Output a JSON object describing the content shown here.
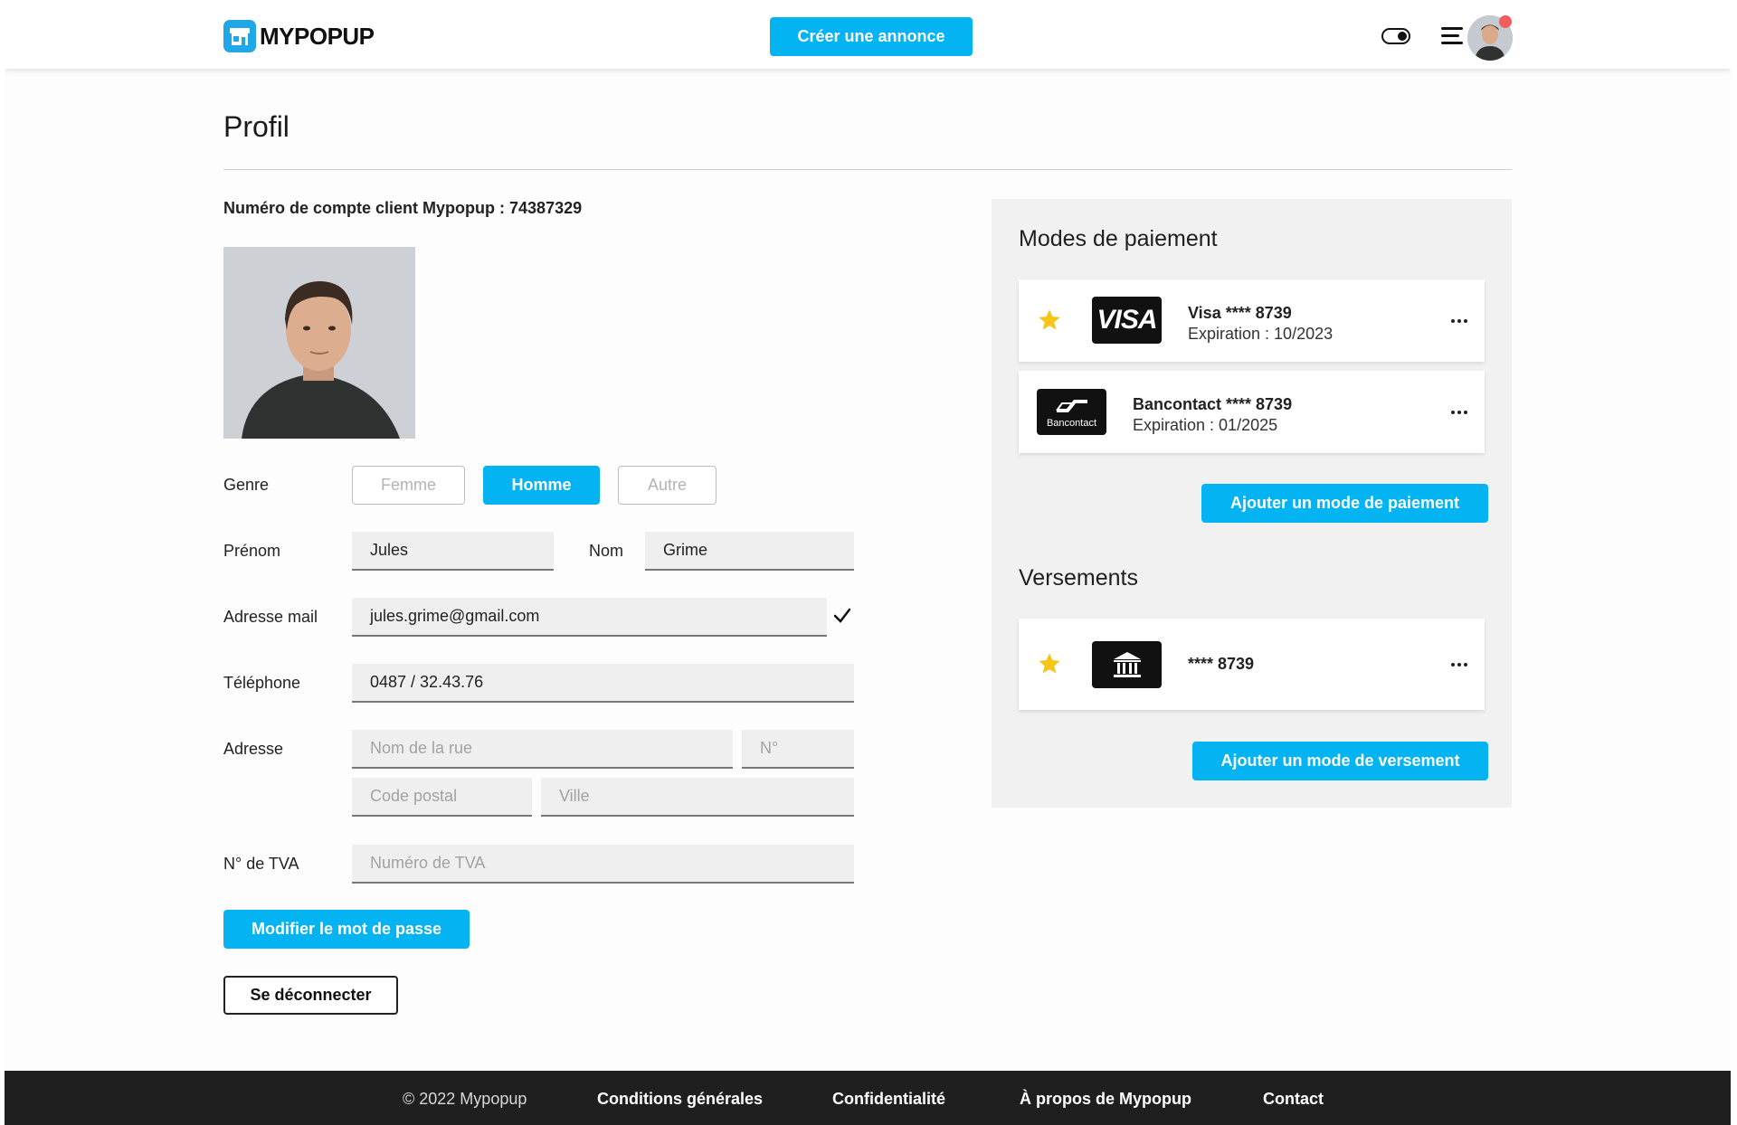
{
  "header": {
    "brand": "MYPOPUP",
    "cta_label": "Créer une annonce"
  },
  "page": {
    "title": "Profil",
    "account_line": "Numéro de compte client Mypopup : 74387329"
  },
  "form": {
    "gender": {
      "label": "Genre",
      "options": [
        "Femme",
        "Homme",
        "Autre"
      ],
      "selected": "Homme"
    },
    "first_name": {
      "label": "Prénom",
      "value": "Jules"
    },
    "last_name": {
      "label": "Nom",
      "value": "Grime"
    },
    "email": {
      "label": "Adresse mail",
      "value": "jules.grime@gmail.com"
    },
    "phone": {
      "label": "Téléphone",
      "value": "0487 / 32.43.76"
    },
    "address": {
      "label": "Adresse",
      "street_placeholder": "Nom de la rue",
      "number_placeholder": "N°",
      "postal_placeholder": "Code postal",
      "city_placeholder": "Ville"
    },
    "vat": {
      "label": "N° de TVA",
      "placeholder": "Numéro de TVA"
    },
    "change_password_label": "Modifier le mot de passe",
    "logout_label": "Se déconnecter"
  },
  "payments": {
    "title": "Modes de paiement",
    "methods": [
      {
        "logo_text": "VISA",
        "name": "Visa **** 8739",
        "expiry": "Expiration : 10/2023",
        "favorite": true
      },
      {
        "logo_text": "Bancontact",
        "name": "Bancontact **** 8739",
        "expiry": "Expiration : 01/2025",
        "favorite": false
      }
    ],
    "add_label": "Ajouter un mode de paiement"
  },
  "payouts": {
    "title": "Versements",
    "accounts": [
      {
        "name": "**** 8739",
        "favorite": true
      }
    ],
    "add_label": "Ajouter un mode de versement"
  },
  "footer": {
    "copyright": "© 2022 Mypopup",
    "links": [
      "Conditions générales",
      "Confidentialité",
      "À propos de Mypopup",
      "Contact"
    ]
  },
  "colors": {
    "accent": "#04b4f2",
    "favorite_star": "#f5c518",
    "footer_bg": "#1f1f1f",
    "notification": "#f25c5c"
  }
}
